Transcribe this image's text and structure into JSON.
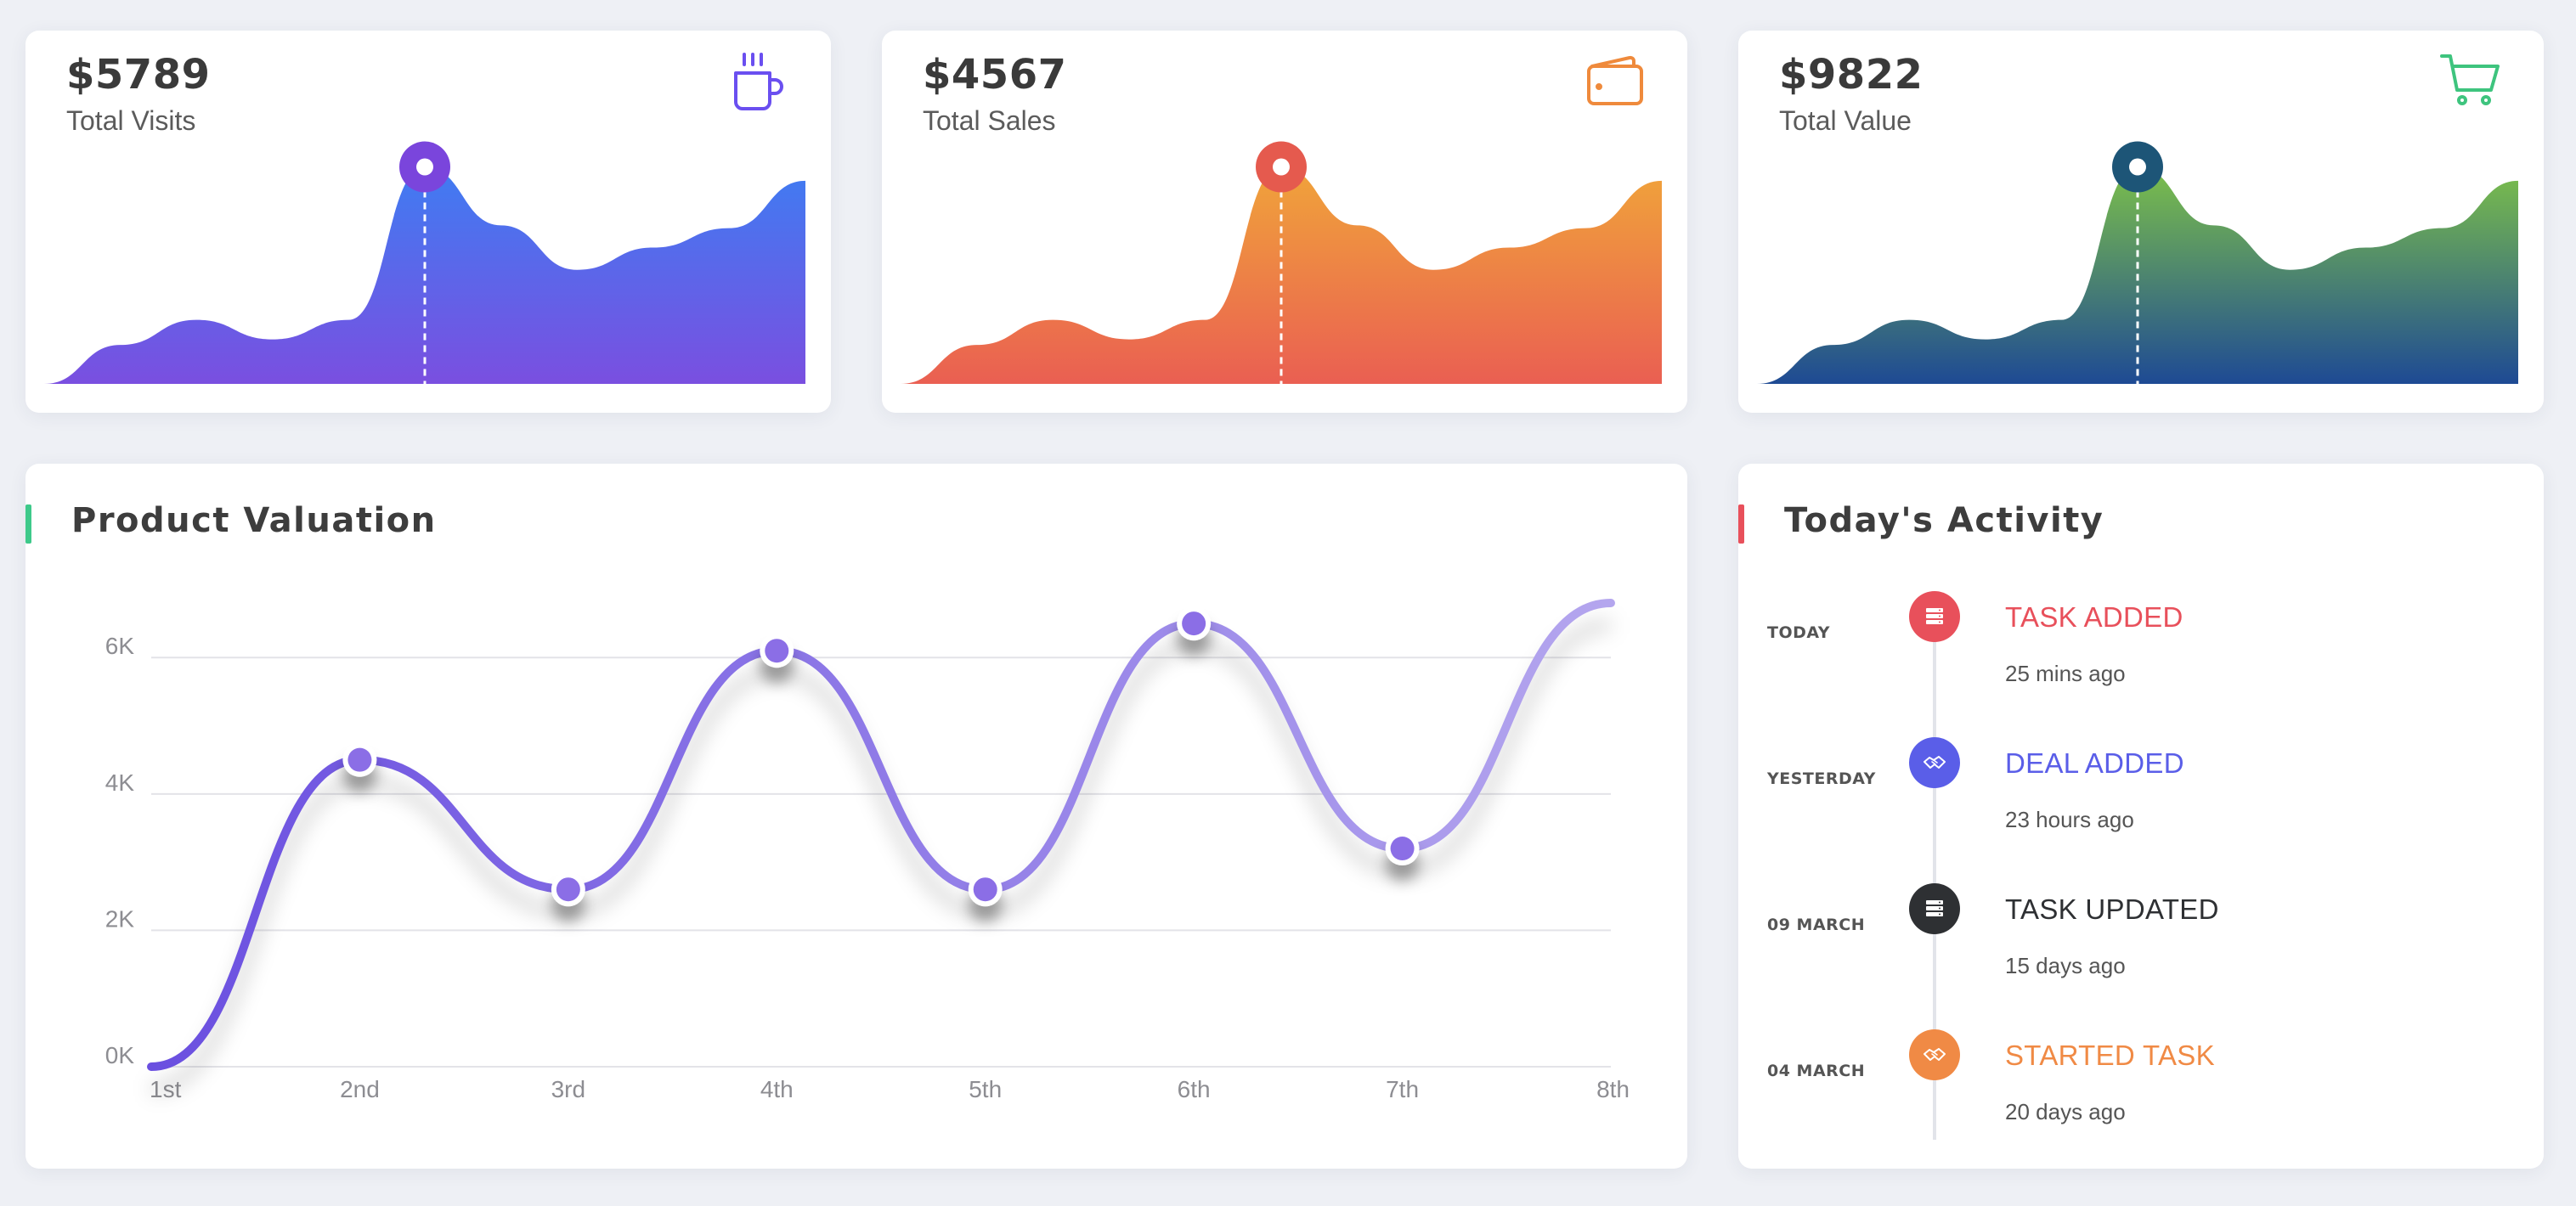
{
  "stats": [
    {
      "value": "$5789",
      "label": "Total Visits",
      "icon": "coffee-cup-icon",
      "icon_color": "#6a4ff0",
      "gradient_top": "#3f7cf2",
      "gradient_bottom": "#7a4fe0",
      "marker_color": "#7a45dc"
    },
    {
      "value": "$4567",
      "label": "Total Sales",
      "icon": "wallet-icon",
      "icon_color": "#ef8a3c",
      "gradient_top": "#f0a43a",
      "gradient_bottom": "#ea5f52",
      "marker_color": "#e55a4e"
    },
    {
      "value": "$9822",
      "label": "Total Value",
      "icon": "shopping-cart-icon",
      "icon_color": "#3ec47e",
      "gradient_top": "#7cc04a",
      "gradient_bottom": "#1e4a94",
      "marker_color": "#1d5577"
    }
  ],
  "valuation": {
    "title": "Product Valuation",
    "accent": "#3ec98a"
  },
  "activity": {
    "title": "Today's Activity",
    "accent": "#e8505b",
    "items": [
      {
        "date": "TODAY",
        "title": "TASK ADDED",
        "time": "25 mins ago",
        "color": "#e8505b",
        "icon": "server-icon"
      },
      {
        "date": "YESTERDAY",
        "title": "DEAL ADDED",
        "time": "23 hours ago",
        "color": "#5a5ee8",
        "icon": "handshake-icon"
      },
      {
        "date": "09 MARCH",
        "title": "TASK UPDATED",
        "time": "15 days ago",
        "color": "#2e3033",
        "icon": "server-icon"
      },
      {
        "date": "04 MARCH",
        "title": "STARTED TASK",
        "time": "20 days ago",
        "color": "#f08a45",
        "icon": "handshake-icon"
      }
    ]
  },
  "chart_data": [
    {
      "type": "area",
      "x": [
        0,
        1,
        2,
        3,
        4,
        5,
        6,
        7,
        8,
        9,
        10
      ],
      "values": [
        0,
        1.4,
        2.3,
        1.6,
        2.3,
        7.8,
        5.7,
        4.1,
        4.9,
        5.6,
        7.3
      ],
      "highlight_index": 5,
      "ylim": [
        0,
        8
      ]
    },
    {
      "type": "area",
      "x": [
        0,
        1,
        2,
        3,
        4,
        5,
        6,
        7,
        8,
        9,
        10
      ],
      "values": [
        0,
        1.4,
        2.3,
        1.6,
        2.3,
        7.8,
        5.7,
        4.1,
        4.9,
        5.6,
        7.3
      ],
      "highlight_index": 5,
      "ylim": [
        0,
        8
      ]
    },
    {
      "type": "area",
      "x": [
        0,
        1,
        2,
        3,
        4,
        5,
        6,
        7,
        8,
        9,
        10
      ],
      "values": [
        0,
        1.4,
        2.3,
        1.6,
        2.3,
        7.8,
        5.7,
        4.1,
        4.9,
        5.6,
        7.3
      ],
      "highlight_index": 5,
      "ylim": [
        0,
        8
      ]
    },
    {
      "type": "line",
      "categories": [
        "1st",
        "2nd",
        "3rd",
        "4th",
        "5th",
        "6th",
        "7th",
        "8th"
      ],
      "values": [
        0,
        4500,
        2600,
        6100,
        2600,
        6500,
        3200,
        6800
      ],
      "marked_points": [
        1,
        2,
        3,
        4,
        5,
        6
      ],
      "yticks": [
        "0K",
        "2K",
        "4K",
        "6K"
      ],
      "ytick_values": [
        0,
        2000,
        4000,
        6000
      ],
      "ylim": [
        0,
        6800
      ],
      "grid": true,
      "line_color_start": "#6a4fe0",
      "line_color_end": "#b4a6ee"
    }
  ]
}
